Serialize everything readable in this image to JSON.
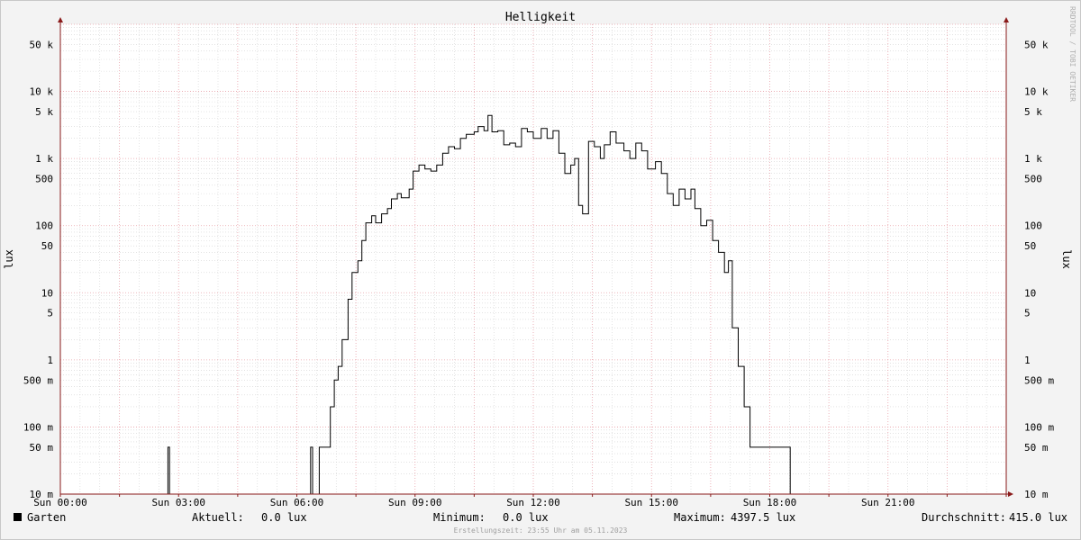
{
  "chart_data": {
    "type": "line",
    "title": "Helligkeit",
    "ylabel": "lux",
    "y_scale": "log",
    "ylim": [
      0.01,
      100000
    ],
    "xlim_hours": [
      0,
      24
    ],
    "watermark": "RRDTOOL / TOBI OETIKER",
    "y_ticks": [
      {
        "value": 50000,
        "label": "50 k"
      },
      {
        "value": 10000,
        "label": "10 k"
      },
      {
        "value": 5000,
        "label": "5 k"
      },
      {
        "value": 1000,
        "label": "1 k"
      },
      {
        "value": 500,
        "label": "500"
      },
      {
        "value": 100,
        "label": "100"
      },
      {
        "value": 50,
        "label": "50"
      },
      {
        "value": 10,
        "label": "10"
      },
      {
        "value": 5,
        "label": "5"
      },
      {
        "value": 1,
        "label": "1"
      },
      {
        "value": 0.5,
        "label": "500 m"
      },
      {
        "value": 0.1,
        "label": "100 m"
      },
      {
        "value": 0.05,
        "label": "50 m"
      },
      {
        "value": 0.01,
        "label": "10 m"
      }
    ],
    "x_ticks": [
      {
        "hour": 0,
        "label": "Sun 00:00"
      },
      {
        "hour": 3,
        "label": "Sun 03:00"
      },
      {
        "hour": 6,
        "label": "Sun 06:00"
      },
      {
        "hour": 9,
        "label": "Sun 09:00"
      },
      {
        "hour": 12,
        "label": "Sun 12:00"
      },
      {
        "hour": 15,
        "label": "Sun 15:00"
      },
      {
        "hour": 18,
        "label": "Sun 18:00"
      },
      {
        "hour": 21,
        "label": "Sun 21:00"
      }
    ],
    "series": [
      {
        "name": "Garten",
        "color": "#000000",
        "points": [
          [
            2.7,
            0.01
          ],
          [
            2.73,
            0.05
          ],
          [
            2.77,
            0.01
          ],
          [
            6.33,
            0.01
          ],
          [
            6.35,
            0.05
          ],
          [
            6.4,
            0.01
          ],
          [
            6.55,
            0.01
          ],
          [
            6.57,
            0.05
          ],
          [
            6.8,
            0.05
          ],
          [
            6.85,
            0.2
          ],
          [
            6.95,
            0.5
          ],
          [
            7.05,
            0.8
          ],
          [
            7.15,
            2
          ],
          [
            7.3,
            8
          ],
          [
            7.4,
            20
          ],
          [
            7.55,
            30
          ],
          [
            7.65,
            60
          ],
          [
            7.75,
            110
          ],
          [
            7.9,
            140
          ],
          [
            8.0,
            110
          ],
          [
            8.15,
            150
          ],
          [
            8.3,
            180
          ],
          [
            8.4,
            250
          ],
          [
            8.55,
            300
          ],
          [
            8.65,
            260
          ],
          [
            8.85,
            350
          ],
          [
            8.95,
            650
          ],
          [
            9.1,
            800
          ],
          [
            9.25,
            700
          ],
          [
            9.4,
            650
          ],
          [
            9.55,
            800
          ],
          [
            9.7,
            1200
          ],
          [
            9.85,
            1500
          ],
          [
            10.0,
            1400
          ],
          [
            10.15,
            2000
          ],
          [
            10.3,
            2300
          ],
          [
            10.5,
            2500
          ],
          [
            10.6,
            3000
          ],
          [
            10.75,
            2600
          ],
          [
            10.85,
            4400
          ],
          [
            10.95,
            2500
          ],
          [
            11.1,
            2600
          ],
          [
            11.25,
            1600
          ],
          [
            11.4,
            1700
          ],
          [
            11.55,
            1500
          ],
          [
            11.7,
            2800
          ],
          [
            11.85,
            2500
          ],
          [
            12.0,
            2000
          ],
          [
            12.2,
            2800
          ],
          [
            12.35,
            2000
          ],
          [
            12.5,
            2600
          ],
          [
            12.65,
            1200
          ],
          [
            12.8,
            600
          ],
          [
            12.95,
            800
          ],
          [
            13.05,
            1000
          ],
          [
            13.15,
            200
          ],
          [
            13.25,
            150
          ],
          [
            13.4,
            1800
          ],
          [
            13.55,
            1500
          ],
          [
            13.7,
            1000
          ],
          [
            13.8,
            1600
          ],
          [
            13.95,
            2500
          ],
          [
            14.1,
            1700
          ],
          [
            14.3,
            1300
          ],
          [
            14.45,
            1000
          ],
          [
            14.6,
            1700
          ],
          [
            14.75,
            1300
          ],
          [
            14.9,
            700
          ],
          [
            15.1,
            900
          ],
          [
            15.25,
            600
          ],
          [
            15.4,
            300
          ],
          [
            15.55,
            200
          ],
          [
            15.7,
            350
          ],
          [
            15.85,
            250
          ],
          [
            16.0,
            350
          ],
          [
            16.1,
            180
          ],
          [
            16.25,
            100
          ],
          [
            16.4,
            120
          ],
          [
            16.55,
            60
          ],
          [
            16.7,
            40
          ],
          [
            16.85,
            20
          ],
          [
            16.95,
            30
          ],
          [
            17.05,
            3
          ],
          [
            17.2,
            0.8
          ],
          [
            17.35,
            0.2
          ],
          [
            17.5,
            0.05
          ],
          [
            18.5,
            0.05
          ],
          [
            18.52,
            0.01
          ],
          [
            24.0,
            0.01
          ]
        ]
      }
    ]
  },
  "legend": {
    "series_name": "Garten",
    "current_label": "Aktuell:",
    "current_value": "0.0 lux",
    "min_label": "Minimum:",
    "min_value": "0.0 lux",
    "max_label": "Maximum:",
    "max_value": "4397.5 lux",
    "avg_label": "Durchschnitt:",
    "avg_value": "415.0 lux"
  },
  "footer": "Erstellungszeit: 23:55 Uhr am 05.11.2023",
  "colors": {
    "background": "#f3f3f3",
    "plot": "#ffffff",
    "major_grid": "#e8a0a8",
    "minor_grid": "#d2d2d2",
    "axis": "#8a1a1a",
    "line": "#000000"
  }
}
